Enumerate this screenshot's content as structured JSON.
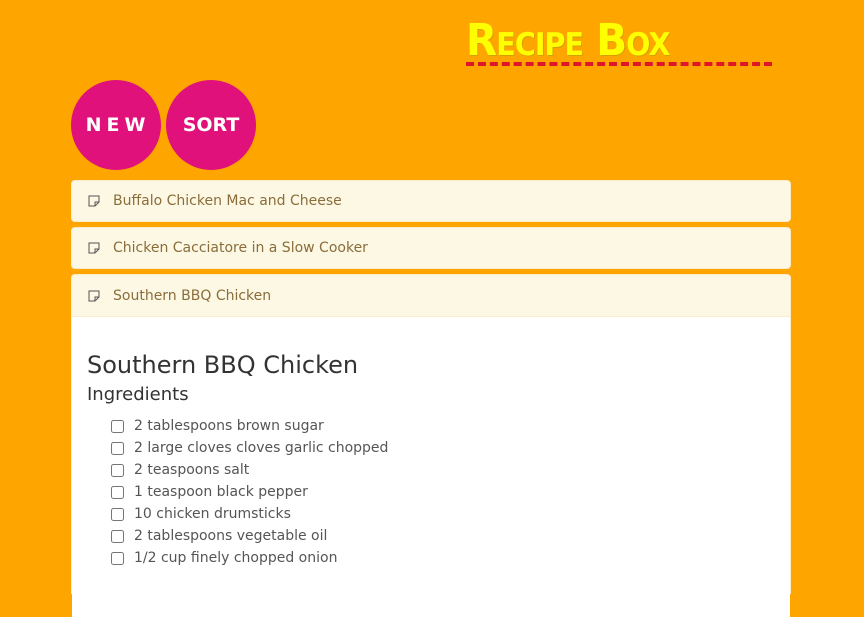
{
  "header": {
    "title": "Recipe Box"
  },
  "actions": {
    "new_label": "NEW",
    "sort_label": "SORT"
  },
  "recipes": [
    {
      "name": "Buffalo Chicken Mac and Cheese"
    },
    {
      "name": "Chicken Cacciatore in a Slow Cooker"
    },
    {
      "name": "Southern BBQ Chicken"
    }
  ],
  "open_recipe": {
    "title": "Southern BBQ Chicken",
    "ingredients_heading": "Ingredients",
    "ingredients": [
      "2 tablespoons brown sugar",
      "2 large cloves cloves garlic chopped",
      "2 teaspoons salt",
      "1 teaspoon black pepper",
      "10 chicken drumsticks",
      "2 tablespoons vegetable oil",
      "1/2 cup finely chopped onion"
    ]
  },
  "colors": {
    "background": "#ffa500",
    "title": "#ffff00",
    "title_underline": "#e0152b",
    "button": "#e0117a",
    "panel_heading_bg": "#fcf8e3",
    "panel_heading_text": "#8a6d3b"
  },
  "icons": {
    "recipe_item": "note-icon"
  }
}
